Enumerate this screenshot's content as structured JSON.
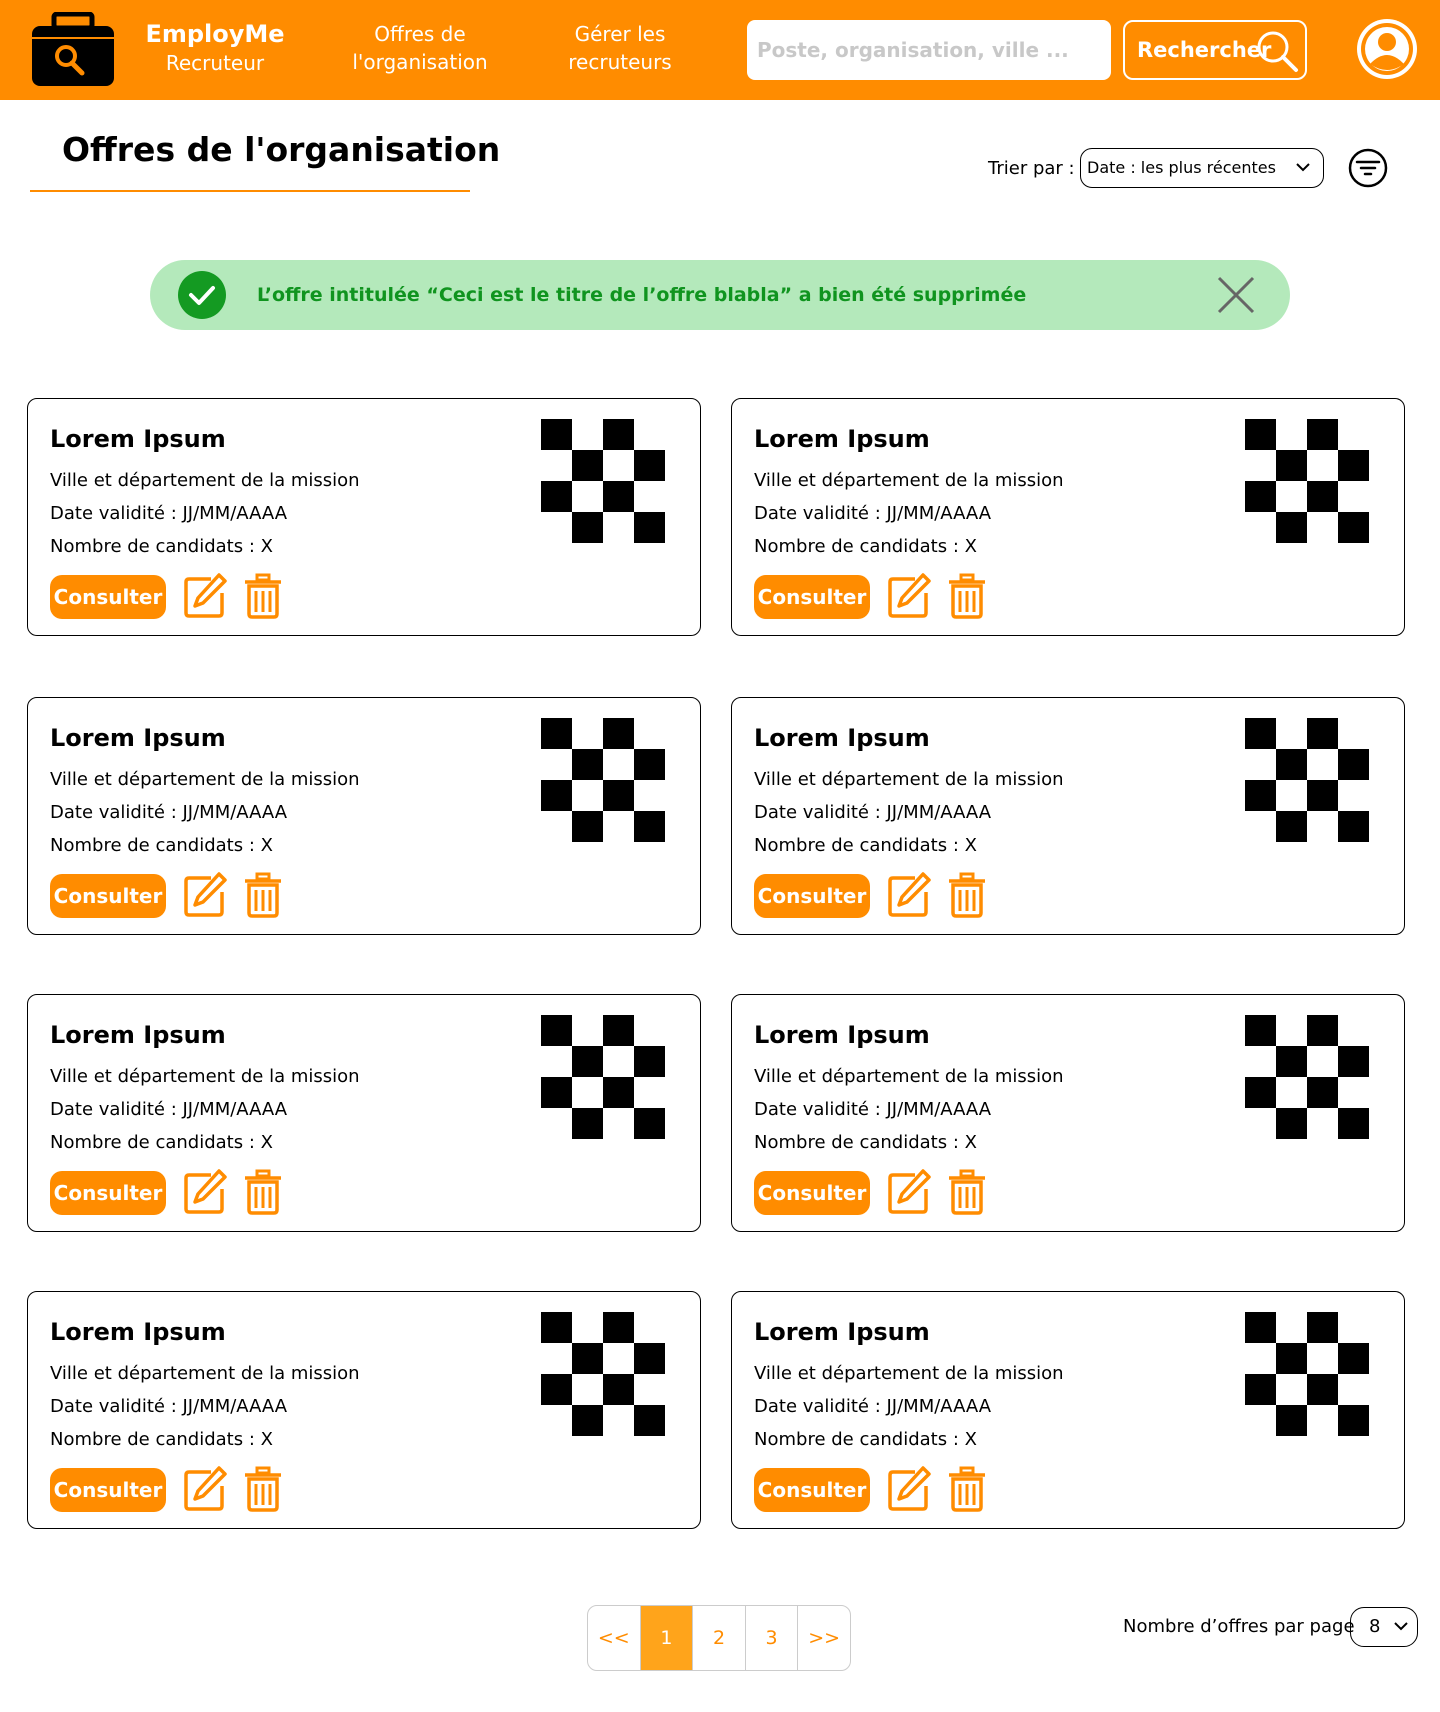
{
  "header": {
    "brand_name": "EmployMe",
    "brand_sub": "Recruteur",
    "nav": [
      {
        "label": "Offres de l'organisation"
      },
      {
        "label": "Gérer les recruteurs"
      }
    ],
    "search_placeholder": "Poste, organisation, ville ...",
    "search_button": "Rechercher",
    "icons": [
      "briefcase-logo-icon",
      "search-icon",
      "user-avatar-icon"
    ]
  },
  "page": {
    "title": "Offres de l'organisation",
    "sort_label": "Trier par :",
    "sort_value": "Date : les plus récentes"
  },
  "alert": {
    "message": "L’offre intitulée “Ceci est le titre de l’offre blabla” a bien été supprimée"
  },
  "cards": [
    {
      "title": "Lorem Ipsum",
      "location": "Ville et département de la mission",
      "validity": "Date validité : JJ/MM/AAAA",
      "candidates": "Nombre de candidats : X",
      "consult": "Consulter"
    },
    {
      "title": "Lorem Ipsum",
      "location": "Ville et département de la mission",
      "validity": "Date validité : JJ/MM/AAAA",
      "candidates": "Nombre de candidats : X",
      "consult": "Consulter"
    },
    {
      "title": "Lorem Ipsum",
      "location": "Ville et département de la mission",
      "validity": "Date validité : JJ/MM/AAAA",
      "candidates": "Nombre de candidats : X",
      "consult": "Consulter"
    },
    {
      "title": "Lorem Ipsum",
      "location": "Ville et département de la mission",
      "validity": "Date validité : JJ/MM/AAAA",
      "candidates": "Nombre de candidats : X",
      "consult": "Consulter"
    },
    {
      "title": "Lorem Ipsum",
      "location": "Ville et département de la mission",
      "validity": "Date validité : JJ/MM/AAAA",
      "candidates": "Nombre de candidats : X",
      "consult": "Consulter"
    },
    {
      "title": "Lorem Ipsum",
      "location": "Ville et département de la mission",
      "validity": "Date validité : JJ/MM/AAAA",
      "candidates": "Nombre de candidats : X",
      "consult": "Consulter"
    },
    {
      "title": "Lorem Ipsum",
      "location": "Ville et département de la mission",
      "validity": "Date validité : JJ/MM/AAAA",
      "candidates": "Nombre de candidats : X",
      "consult": "Consulter"
    },
    {
      "title": "Lorem Ipsum",
      "location": "Ville et département de la mission",
      "validity": "Date validité : JJ/MM/AAAA",
      "candidates": "Nombre de candidats : X",
      "consult": "Consulter"
    }
  ],
  "pagination": {
    "prev": "<<",
    "pages": [
      "1",
      "2",
      "3"
    ],
    "current": "1",
    "next": ">>",
    "per_page_label": "Nombre d’offres par page",
    "per_page_value": "8"
  },
  "colors": {
    "brand": "#ff8c00",
    "alert_bg": "#b4e9bb",
    "alert_text": "#10941f",
    "active_page": "#ffa41b"
  }
}
